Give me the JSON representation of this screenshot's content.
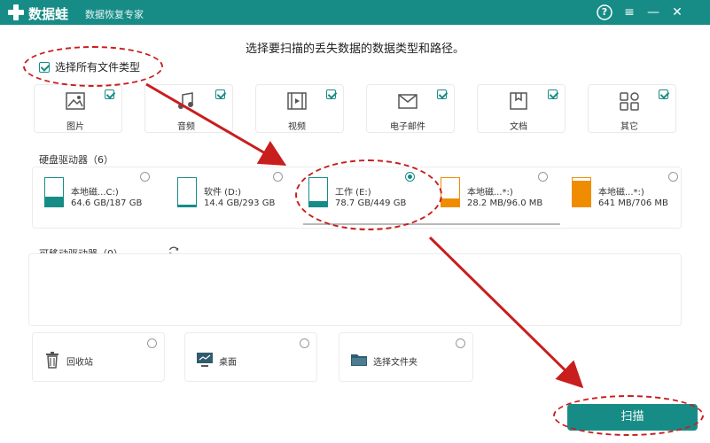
{
  "app": {
    "name": "数据蛙",
    "subtitle": "数据恢复专家",
    "help_icon": "?",
    "menu_icon": "≡",
    "minimize_icon": "—",
    "close_icon": "✕"
  },
  "instruction": "选择要扫描的丢失数据的数据类型和路径。",
  "select_all": {
    "label": "选择所有文件类型",
    "checked": true
  },
  "file_types": [
    {
      "label": "图片",
      "icon": "image-icon",
      "checked": true
    },
    {
      "label": "音频",
      "icon": "audio-icon",
      "checked": true
    },
    {
      "label": "视频",
      "icon": "video-icon",
      "checked": true
    },
    {
      "label": "电子邮件",
      "icon": "email-icon",
      "checked": true
    },
    {
      "label": "文档",
      "icon": "document-icon",
      "checked": true
    },
    {
      "label": "其它",
      "icon": "other-icon",
      "checked": true
    }
  ],
  "hard_drives": {
    "title": "硬盘驱动器（6）",
    "items": [
      {
        "name": "本地磁...C:)",
        "size": "64.6 GB/187 GB",
        "used_fraction": 0.35,
        "color": "#178c87",
        "selected": false
      },
      {
        "name": "软件 (D:)",
        "size": "14.4 GB/293 GB",
        "used_fraction": 0.05,
        "color": "#178c87",
        "selected": false
      },
      {
        "name": "工作 (E:)",
        "size": "78.7 GB/449 GB",
        "used_fraction": 0.18,
        "color": "#178c87",
        "selected": true
      },
      {
        "name": "本地磁...*:)",
        "size": "28.2 MB/96.0 MB",
        "used_fraction": 0.29,
        "color": "#f08c00",
        "selected": false
      },
      {
        "name": "本地磁...*:)",
        "size": "641 MB/706 MB",
        "used_fraction": 0.91,
        "color": "#f08c00",
        "selected": false
      }
    ]
  },
  "removable": {
    "title": "可移动驱动器（0）",
    "refresh_icon": "refresh-icon"
  },
  "locations": [
    {
      "label": "回收站",
      "icon": "recycle-bin-icon"
    },
    {
      "label": "桌面",
      "icon": "desktop-icon"
    },
    {
      "label": "选择文件夹",
      "icon": "folder-icon"
    }
  ],
  "scan_button": "扫描",
  "colors": {
    "accent": "#178c87",
    "warning_drive": "#f08c00",
    "annotation": "#c91e1e"
  }
}
